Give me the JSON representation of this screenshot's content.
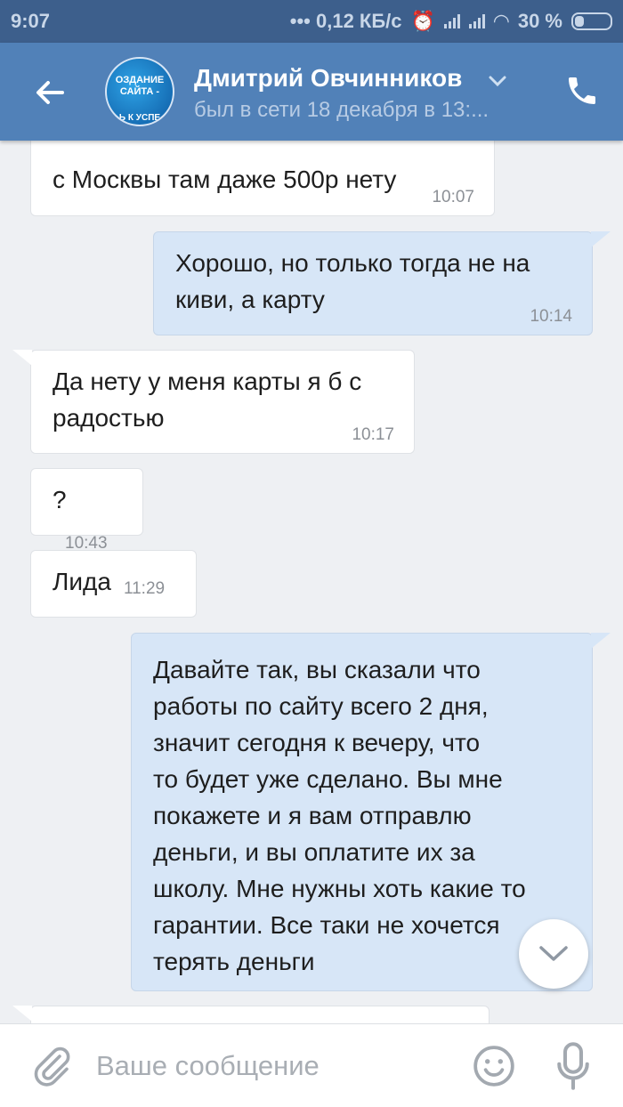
{
  "status_bar": {
    "time": "9:07",
    "network_speed": "0,12 КБ/с",
    "battery_percent": "30 %"
  },
  "header": {
    "contact_name": "Дмитрий Овчинников",
    "contact_status": "был в сети 18 декабря в 13:...",
    "avatar_text_line1": "ОЗДАНИЕ",
    "avatar_text_line2": "САЙТА -",
    "avatar_text_line3": "Ь К УСПЕ"
  },
  "messages": [
    {
      "direction": "in",
      "text": "с Москвы там даже 500р нету",
      "time": "10:07"
    },
    {
      "direction": "out",
      "text": "Хорошо,  но только тогда не на\nкиви,  а карту",
      "time": "10:14"
    },
    {
      "direction": "in",
      "text": "Да нету у меня карты я б с\nрадостью",
      "time": "10:17"
    },
    {
      "direction": "in",
      "text": "?",
      "time": "10:43"
    },
    {
      "direction": "in",
      "text": "Лида",
      "time": "11:29"
    },
    {
      "direction": "out",
      "text": "Давайте так,  вы сказали что\nработы по сайту всего 2 дня,\nзначит сегодня к вечеру,  что\nто будет уже сделано.  Вы мне\nпокажете и я вам отправлю\nденьги,  и вы оплатите их за\nшколу. Мне нужны хоть какие то\nгарантии.  Все таки не хочется\nтерять деньги",
      "time": ""
    }
  ],
  "composer": {
    "placeholder": "Ваше сообщение"
  },
  "colors": {
    "header": "#5181b8",
    "status_bar": "#3d5f8c",
    "incoming_bubble": "#ffffff",
    "outgoing_bubble": "#d7e6f7",
    "background": "#eef0f3"
  },
  "icons": {
    "back": "arrow-left-icon",
    "call": "phone-icon",
    "scroll": "chevron-down-icon",
    "attach": "paperclip-icon",
    "emoji": "smile-icon",
    "voice": "microphone-icon"
  }
}
